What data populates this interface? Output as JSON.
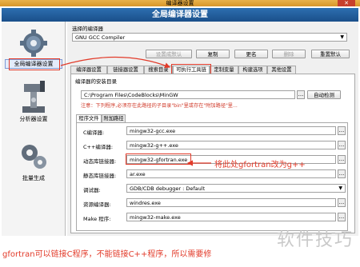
{
  "window": {
    "title": "编译器设置",
    "close_glyph": "✕"
  },
  "header": {
    "title": "全局编译器设置"
  },
  "nav": [
    {
      "label": "全局编译器设置",
      "icon": "gear-icon"
    },
    {
      "label": "分析器设置",
      "icon": "robot-arm-icon"
    },
    {
      "label": "批量生成",
      "icon": "gears-icon"
    }
  ],
  "compiler": {
    "select_label": "选择的编译器",
    "selected": "GNU GCC Compiler",
    "buttons": [
      "设置成默认",
      "复制",
      "更名",
      "删除",
      "重置默认"
    ]
  },
  "tabs": [
    "编译器设置",
    "链接器设置",
    "搜索目录",
    "可执行工具链",
    "定制变量",
    "构建选项",
    "其他设置"
  ],
  "toolchain": {
    "install_dir_label": "编译器的安装目录",
    "install_dir": "C:\\Program Files\\CodeBlocks\\MinGW",
    "dots": "...",
    "autodetect": "自动检测",
    "note": "注意：下列程序,必须存在此路径的子目录\"bin\"里或存在\"附加路径\"里...",
    "subtabs": [
      "程序文件",
      "附加路径"
    ],
    "rows": [
      {
        "label": "C编译器:",
        "value": "mingw32-gcc.exe"
      },
      {
        "label": "C++编译器:",
        "value": "mingw32-g++.exe"
      },
      {
        "label": "动态库链接器:",
        "value": "mingw32-gfortran.exe"
      },
      {
        "label": "静态库链接器:",
        "value": "ar.exe"
      },
      {
        "label": "调试器:",
        "value": "GDB/CDB debugger : Default"
      },
      {
        "label": "资源编译器:",
        "value": "windres.exe"
      },
      {
        "label": "Make 程序:",
        "value": "mingw32-make.exe"
      }
    ]
  },
  "annotation": {
    "arrow_text": "将此处gfortran改为g++",
    "bottom_note": "gfortran可以链接C程序，不能链接C++程序，所以需要修",
    "watermark": "软件技巧",
    "color": "#e23b2a"
  }
}
